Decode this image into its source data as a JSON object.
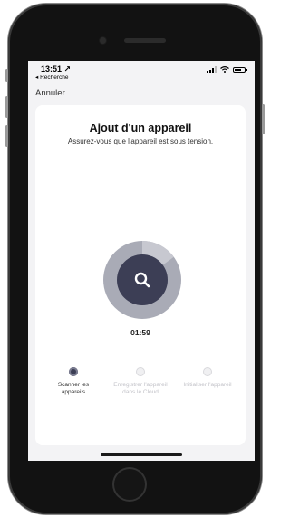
{
  "status_bar": {
    "time": "13:51 ↗",
    "back_label": "◂ Recherche"
  },
  "header": {
    "cancel_label": "Annuler"
  },
  "card": {
    "title": "Ajout d'un appareil",
    "subtitle": "Assurez-vous que l'appareil est sous tension."
  },
  "scan": {
    "timer": "01:59",
    "icon": "search-icon",
    "progress_fraction": 0.15
  },
  "steps": [
    {
      "label": "Scanner les appareils",
      "state": "active",
      "icon": "scan-step-icon"
    },
    {
      "label": "Enregistrer l'appareil dans le Cloud",
      "state": "inactive",
      "icon": "cloud-icon"
    },
    {
      "label": "Initialiser l'appareil",
      "state": "inactive",
      "icon": "device-init-icon"
    }
  ],
  "colors": {
    "accent": "#3c3e55",
    "ring": "#a9abb6",
    "ring_progress": "#c7c8d0",
    "background": "#f3f3f5"
  }
}
